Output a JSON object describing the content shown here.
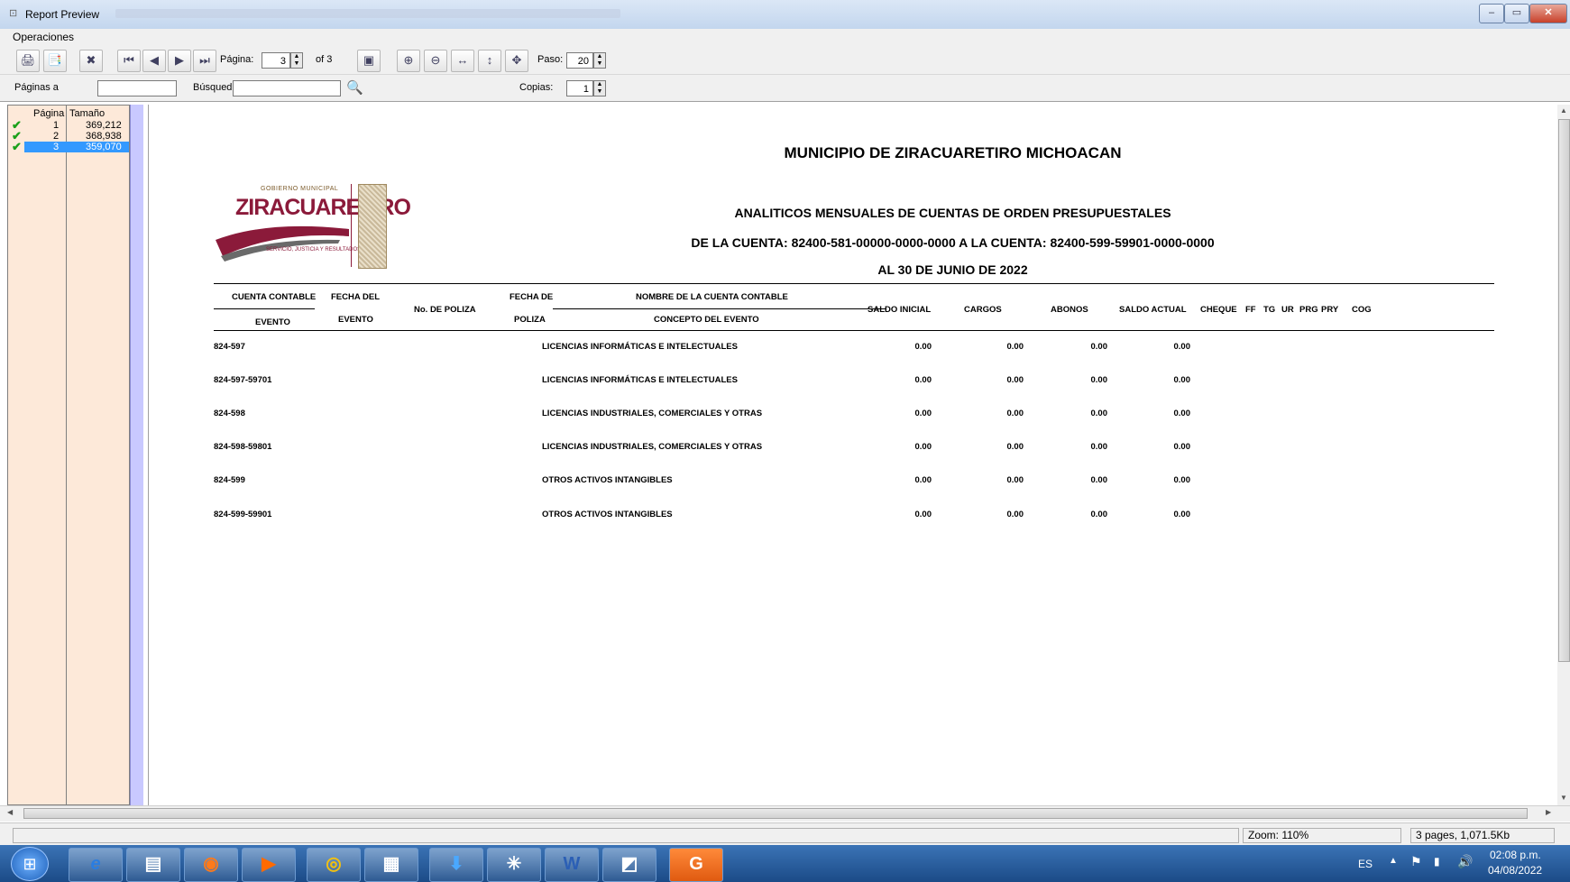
{
  "window": {
    "title": "Report Preview",
    "min": "–",
    "max": "▭",
    "close": "✕"
  },
  "menu": {
    "operaciones": "Operaciones"
  },
  "toolbar": {
    "pagina_label": "Página:",
    "page_current": "3",
    "of_label": "of 3",
    "paso_label": "Paso:",
    "paso_value": "20"
  },
  "row2": {
    "paginas_label": "Páginas a",
    "busqueda_label": "Búsqued",
    "copias_label": "Copias:",
    "copias_value": "1"
  },
  "pages_list": {
    "col_pagina": "Página",
    "col_tamano": "Tamaño",
    "rows": [
      {
        "page": "1",
        "size": "369,212"
      },
      {
        "page": "2",
        "size": "368,938"
      },
      {
        "page": "3",
        "size": "359,070"
      }
    ]
  },
  "report": {
    "title": "MUNICIPIO DE ZIRACUARETIRO MICHOACAN",
    "subtitle": "ANALITICOS MENSUALES DE CUENTAS DE ORDEN PRESUPUESTALES",
    "range": "DE LA CUENTA: 82400-581-00000-0000-0000 A LA CUENTA: 82400-599-59901-0000-0000",
    "date": "AL 30 DE JUNIO DE 2022",
    "logo": {
      "top": "GOBIERNO MUNICIPAL",
      "name": "ZIRACUARETIRO",
      "slogan": "SERVICIO, JUSTICIA Y RESULTADOS"
    },
    "headers": {
      "cuenta_contable": "CUENTA CONTABLE",
      "evento1": "EVENTO",
      "fecha_del": "FECHA DEL",
      "evento2": "EVENTO",
      "no_poliza": "No. DE POLIZA",
      "fecha_de": "FECHA DE",
      "poliza": "POLIZA",
      "nombre_cuenta": "NOMBRE DE LA CUENTA CONTABLE",
      "concepto": "CONCEPTO DEL EVENTO",
      "saldo_inicial": "SALDO INICIAL",
      "cargos": "CARGOS",
      "abonos": "ABONOS",
      "saldo_actual": "SALDO ACTUAL",
      "cheque": "CHEQUE",
      "ff": "FF",
      "tg": "TG",
      "ur": "UR",
      "prg": "PRG",
      "pry": "PRY",
      "cog": "COG"
    },
    "rows": [
      {
        "cuenta": "824-597",
        "nombre": "LICENCIAS INFORMÁTICAS E INTELECTUALES",
        "saldo_inicial": "0.00",
        "cargos": "0.00",
        "abonos": "0.00",
        "saldo_actual": "0.00"
      },
      {
        "cuenta": "824-597-59701",
        "nombre": "LICENCIAS INFORMÁTICAS E INTELECTUALES",
        "saldo_inicial": "0.00",
        "cargos": "0.00",
        "abonos": "0.00",
        "saldo_actual": "0.00"
      },
      {
        "cuenta": "824-598",
        "nombre": "LICENCIAS INDUSTRIALES, COMERCIALES Y OTRAS",
        "saldo_inicial": "0.00",
        "cargos": "0.00",
        "abonos": "0.00",
        "saldo_actual": "0.00"
      },
      {
        "cuenta": "824-598-59801",
        "nombre": "LICENCIAS INDUSTRIALES, COMERCIALES Y OTRAS",
        "saldo_inicial": "0.00",
        "cargos": "0.00",
        "abonos": "0.00",
        "saldo_actual": "0.00"
      },
      {
        "cuenta": "824-599",
        "nombre": "OTROS ACTIVOS INTANGIBLES",
        "saldo_inicial": "0.00",
        "cargos": "0.00",
        "abonos": "0.00",
        "saldo_actual": "0.00"
      },
      {
        "cuenta": "824-599-59901",
        "nombre": "OTROS ACTIVOS INTANGIBLES",
        "saldo_inicial": "0.00",
        "cargos": "0.00",
        "abonos": "0.00",
        "saldo_actual": "0.00"
      }
    ]
  },
  "status": {
    "zoom": "Zoom: 110%",
    "pages": "3 pages, 1,071.5Kb"
  },
  "taskbar": {
    "lang": "ES",
    "time": "02:08 p.m.",
    "date": "04/08/2022"
  },
  "colors": {
    "accent_selected": "#3399ff",
    "left_panel": "#fde9d9",
    "logo_red": "#8b1a3a",
    "check_green": "#1aa01a"
  }
}
